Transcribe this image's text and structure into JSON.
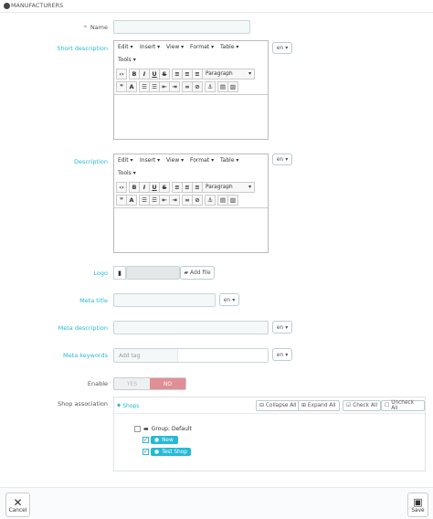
{
  "header": {
    "title": "MANUFACTURERS"
  },
  "form": {
    "name_label": "Name",
    "name_required_mark": "*",
    "short_description_label": "Short description",
    "description_label": "Description",
    "logo_label": "Logo",
    "add_file_label": "Add file",
    "meta_title_label": "Meta title",
    "meta_description_label": "Meta description",
    "meta_keywords_label": "Meta keywords",
    "meta_keywords_placeholder": "Add tag",
    "enable_label": "Enable",
    "enable_yes": "YES",
    "enable_no": "NO",
    "shop_association_label": "Shop association",
    "lang": "en"
  },
  "editor": {
    "menus": [
      "Edit",
      "Insert",
      "View",
      "Format",
      "Table",
      "Tools"
    ],
    "format_select": "Paragraph"
  },
  "shops": {
    "tab_label": "Shops",
    "collapse_all": "Collapse All",
    "expand_all": "Expand All",
    "check_all": "Check All",
    "uncheck_all": "Uncheck All",
    "group_label": "Group: Default",
    "shop_1": "New",
    "shop_2": "Test Shop"
  },
  "footer": {
    "cancel": "Cancel",
    "save": "Save"
  },
  "colors": {
    "accent": "#25b9d7",
    "required": "#e95b5b",
    "no_active": "#e08f95"
  }
}
